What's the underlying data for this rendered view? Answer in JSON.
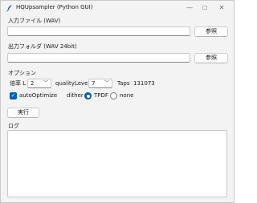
{
  "window": {
    "title": "HQUpsampler (Python GUI)"
  },
  "input_section": {
    "label": "入力ファイル (WAV)",
    "value": "",
    "browse_label": "参照"
  },
  "output_section": {
    "label": "出力フォルダ (WAV 24bit)",
    "value": "",
    "browse_label": "参照"
  },
  "options": {
    "label": "オプション",
    "ratio_label": "倍率 L",
    "ratio_value": "2",
    "quality_label": "qualityLevel",
    "quality_value": "7",
    "taps_label": "Taps",
    "taps_value": "131073",
    "auto_optimize_label": "autoOptimize",
    "auto_optimize_checked": true,
    "dither_label": "dither",
    "dither_options": [
      "TPDF",
      "none"
    ],
    "dither_selected": "TPDF"
  },
  "run_label": "実行",
  "log": {
    "label": "ログ",
    "content": ""
  }
}
